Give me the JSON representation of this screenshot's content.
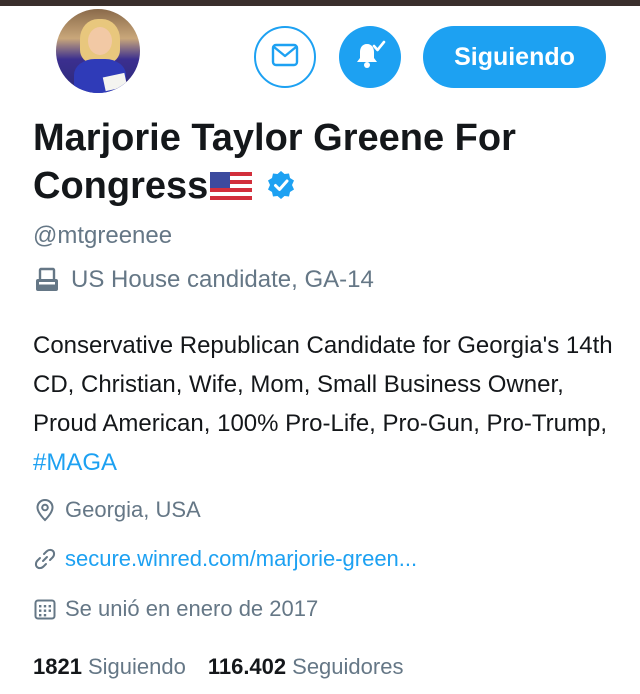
{
  "profile": {
    "name": "Marjorie Taylor Greene For Congress",
    "handle": "@mtgreenee",
    "category": "US House candidate, GA-14",
    "bio_text": "Conservative Republican Candidate for Georgia's 14th CD, Christian, Wife, Mom, Small Business Owner, Proud American, 100% Pro-Life, Pro-Gun, Pro-Trump,",
    "bio_hashtag": "#MAGA",
    "location": "Georgia, USA",
    "website": "secure.winred.com/marjorie-green...",
    "joined": "Se unió en enero de 2017"
  },
  "actions": {
    "follow_label": "Siguiendo",
    "message_icon": "envelope-icon",
    "notify_icon": "bell-check-icon"
  },
  "stats": {
    "following_count": "1821",
    "following_label": "Siguiendo",
    "followers_count": "116.402",
    "followers_label": "Seguidores"
  },
  "colors": {
    "accent": "#1da1f2",
    "secondary_text": "#657786",
    "primary_text": "#14171a"
  }
}
